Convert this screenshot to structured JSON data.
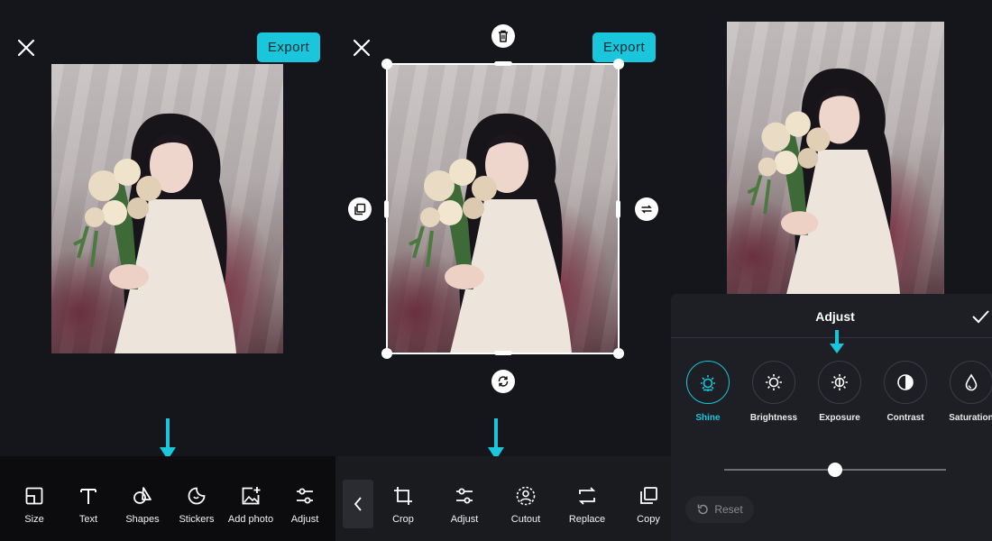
{
  "colors": {
    "accent": "#19c6dc",
    "background": "#15161b",
    "toolbar": "#0c0c0f",
    "sheet": "#1e1f24"
  },
  "panel1": {
    "export_label": "Export",
    "tools": [
      {
        "label": "Size",
        "icon": "size-icon"
      },
      {
        "label": "Text",
        "icon": "text-icon"
      },
      {
        "label": "Shapes",
        "icon": "shapes-icon"
      },
      {
        "label": "Stickers",
        "icon": "stickers-icon"
      },
      {
        "label": "Add photo",
        "icon": "add-photo-icon"
      },
      {
        "label": "Adjust",
        "icon": "adjust-icon"
      }
    ]
  },
  "panel2": {
    "export_label": "Export",
    "tools": [
      {
        "label": "Crop",
        "icon": "crop-icon"
      },
      {
        "label": "Adjust",
        "icon": "adjust-icon"
      },
      {
        "label": "Cutout",
        "icon": "cutout-icon"
      },
      {
        "label": "Replace",
        "icon": "replace-icon"
      },
      {
        "label": "Copy",
        "icon": "copy-icon"
      }
    ]
  },
  "panel3": {
    "title": "Adjust",
    "options": [
      {
        "label": "Shine",
        "icon": "shine-icon",
        "active": true
      },
      {
        "label": "Brightness",
        "icon": "brightness-icon",
        "active": false
      },
      {
        "label": "Exposure",
        "icon": "exposure-icon",
        "active": false
      },
      {
        "label": "Contrast",
        "icon": "contrast-icon",
        "active": false
      },
      {
        "label": "Saturation",
        "icon": "saturation-icon",
        "active": false
      }
    ],
    "slider_level": 0.5,
    "reset_label": "Reset"
  }
}
